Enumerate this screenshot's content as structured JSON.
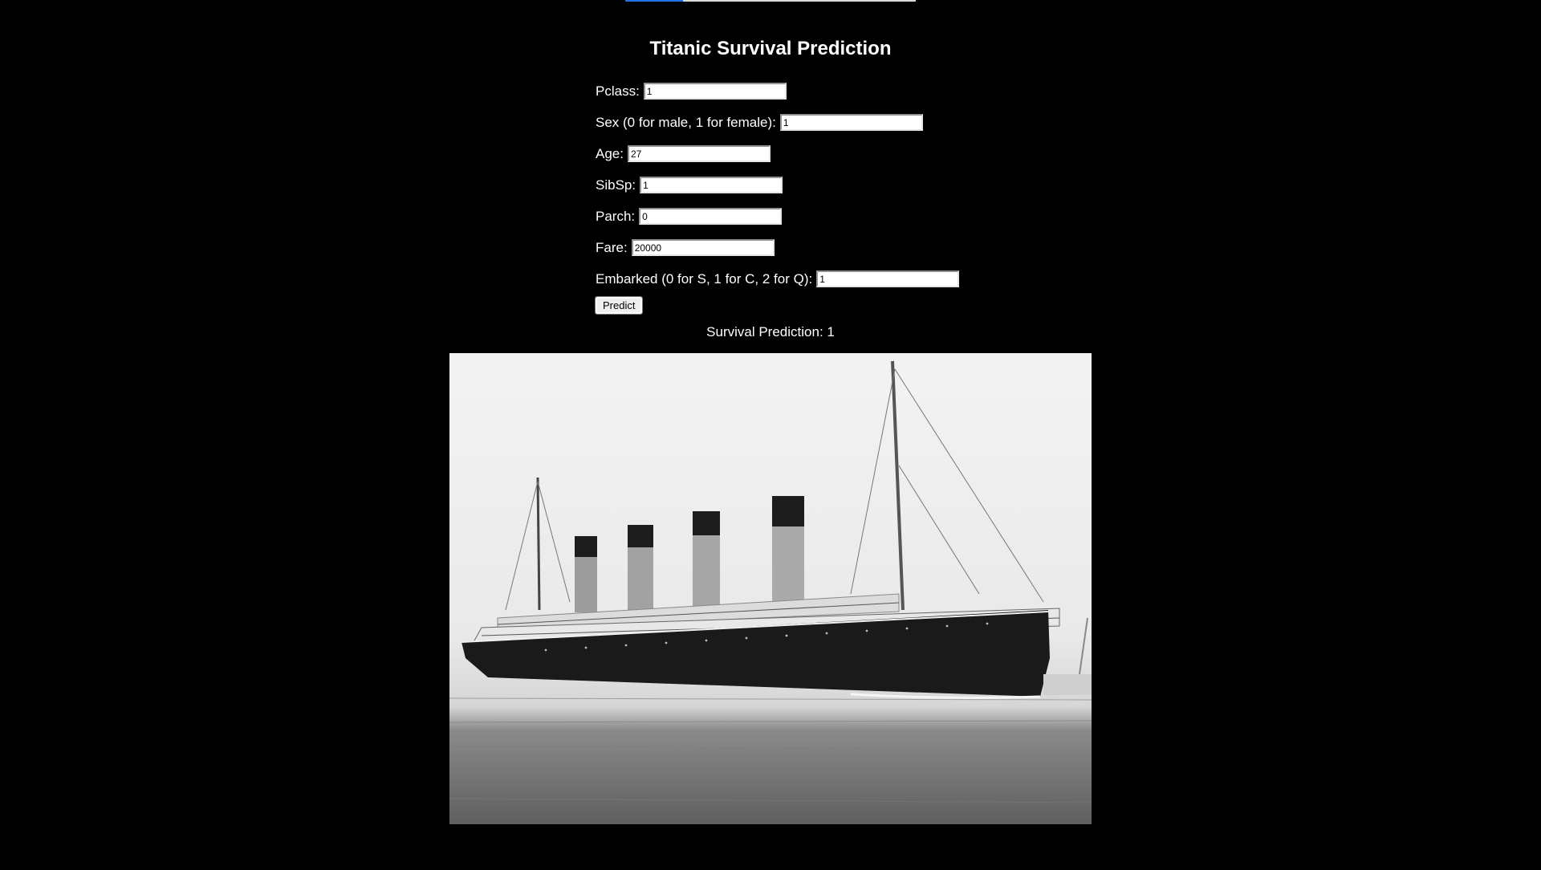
{
  "progress": {
    "fraction": 0.2
  },
  "title": "Titanic Survival Prediction",
  "form": {
    "fields": [
      {
        "label": "Pclass:",
        "value": "1"
      },
      {
        "label": "Sex (0 for male, 1 for female):",
        "value": "1"
      },
      {
        "label": "Age:",
        "value": "27"
      },
      {
        "label": "SibSp:",
        "value": "1"
      },
      {
        "label": "Parch:",
        "value": "0"
      },
      {
        "label": "Fare:",
        "value": "20000"
      },
      {
        "label": "Embarked (0 for S, 1 for C, 2 for Q):",
        "value": "1"
      }
    ],
    "submit_label": "Predict"
  },
  "result": "Survival Prediction: 1",
  "image": {
    "subject": "titanic-ship-photo"
  }
}
